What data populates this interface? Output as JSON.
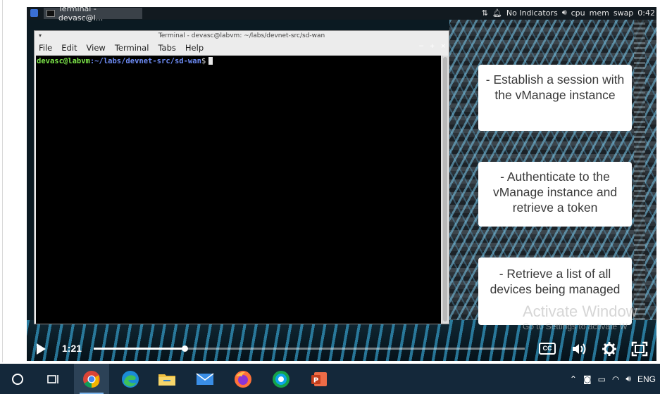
{
  "desktop": {
    "task_title": "Terminal - devasc@l...",
    "indicators": "No Indicators",
    "cpu": "cpu",
    "mem": "mem",
    "swap": "swap",
    "clock": "0:42"
  },
  "terminal": {
    "title": "Terminal - devasc@labvm: ~/labs/devnet-src/sd-wan",
    "menu": [
      "File",
      "Edit",
      "View",
      "Terminal",
      "Tabs",
      "Help"
    ],
    "prompt_user": "devasc@labvm",
    "prompt_path": ":~/labs/devnet-src/sd-wan",
    "prompt_symbol": "$"
  },
  "callouts": [
    "- Establish a session with the vManage instance",
    "- Authenticate to the vManage instance and retrieve a token",
    "- Retrieve a list of all devices being managed"
  ],
  "watermark": {
    "title": "Activate Window",
    "subtitle": "Go to Settings to activate W"
  },
  "player": {
    "current_time": "1:21",
    "progress": 0.21,
    "cc_label": "CC"
  },
  "taskbar": {
    "apps": [
      "search",
      "task-view",
      "chrome",
      "edge",
      "file-explorer",
      "mail",
      "firefox",
      "webex",
      "powerpoint"
    ],
    "active": "chrome",
    "language": "ENG",
    "colors": {
      "background": "#14283a",
      "accent": "#7fb8ee"
    }
  }
}
